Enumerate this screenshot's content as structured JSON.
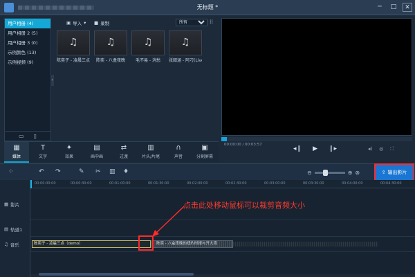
{
  "window": {
    "title": "无标题 *",
    "controls": [
      "─",
      "□",
      "✕"
    ]
  },
  "library": {
    "items": [
      {
        "label": "用户相册 (4)",
        "active": true
      },
      {
        "label": "用户相册 2 (5)",
        "active": false
      },
      {
        "label": "用户相册 3 (0)",
        "active": false
      },
      {
        "label": "示例颜色 (13)",
        "active": false
      },
      {
        "label": "示例视频 (9)",
        "active": false
      }
    ],
    "collapse_glyph": "‹",
    "footer_icons": [
      "add-icon",
      "remove-icon"
    ]
  },
  "media": {
    "import_label": "导入",
    "record_label": "录制",
    "filter_value": "所有",
    "clips": [
      {
        "caption": "陈奕子 - 凌晨三点"
      },
      {
        "caption": "陈奕 - 八盒夜晚"
      },
      {
        "caption": "毛不易 - 消愁"
      },
      {
        "caption": "张韶涵 - 阿刁(Live"
      }
    ]
  },
  "preview": {
    "timecode": "00:00:00 / 00:03:57",
    "progress": 0.03
  },
  "tabs": [
    {
      "label": "媒体",
      "icon": "media-icon",
      "active": true
    },
    {
      "label": "文字",
      "icon": "text-icon"
    },
    {
      "label": "效果",
      "icon": "effects-icon"
    },
    {
      "label": "画中画",
      "icon": "pip-icon"
    },
    {
      "label": "过渡",
      "icon": "transition-icon"
    },
    {
      "label": "片头/片尾",
      "icon": "intro-icon"
    },
    {
      "label": "声音",
      "icon": "audio-icon"
    },
    {
      "label": "分割屏幕",
      "icon": "splitscreen-icon"
    }
  ],
  "timeline": {
    "export_label": "输出影片",
    "ruler_ticks": [
      "00:00:00:00",
      "00:00:30:00",
      "00:01:00:00",
      "00:01:30:00",
      "00:02:00:00",
      "00:02:30:00",
      "00:03:00:00",
      "00:03:30:00",
      "00:04:00:00",
      "00:04:30:00"
    ],
    "tracks": [
      {
        "label": "影片"
      },
      {
        "label": "轨道1"
      },
      {
        "label": "音乐"
      }
    ],
    "clip1_label": "陈奕子 - 凌晨三点（demo）",
    "clip2_label": "陈奕 - 八盒夜晚的纽约时报与开大宵",
    "annotation": "点击此处移动鼠标可以裁剪音频大小"
  }
}
